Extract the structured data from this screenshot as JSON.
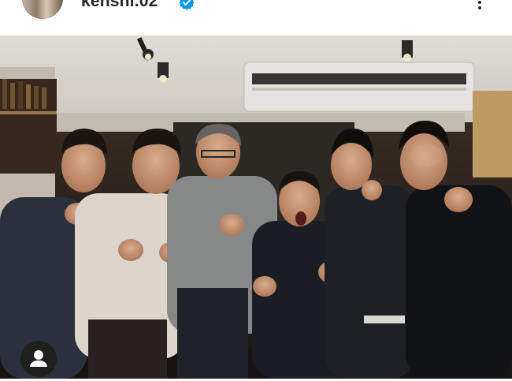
{
  "header": {
    "username": "kenshi.02",
    "avatar_icon": "profile-avatar",
    "verified_icon": "verified-badge-icon",
    "more_icon": "more-options-icon"
  },
  "post": {
    "image_subject": "six-men-posing-group-photo",
    "user_tag_icon": "user-tag-icon"
  },
  "colors": {
    "header_bg": "#ffffff",
    "text": "#262626",
    "verified": "#0095f6"
  }
}
